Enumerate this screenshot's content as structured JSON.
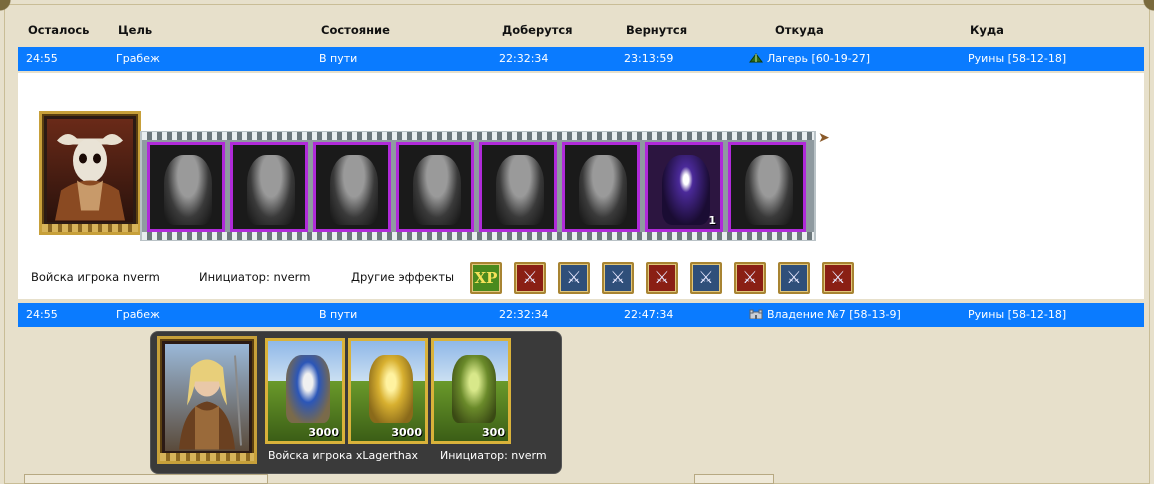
{
  "columns": {
    "remaining": "Осталось",
    "goal": "Цель",
    "state": "Состояние",
    "arrive": "Доберутся",
    "return": "Вернутся",
    "from": "Откуда",
    "to": "Куда"
  },
  "rows": [
    {
      "remaining": "24:55",
      "goal": "Грабеж",
      "state": "В пути",
      "arrive": "22:32:34",
      "return": "23:13:59",
      "from_icon": "camp-tent-icon",
      "from": "Лагерь [60-19-27]",
      "to": "Руины [58-12-18]"
    },
    {
      "remaining": "24:55",
      "goal": "Грабеж",
      "state": "В пути",
      "arrive": "22:32:34",
      "return": "22:47:34",
      "from_icon": "castle-icon",
      "from": "Владение №7 [58-13-9]",
      "to": "Руины [58-12-18]"
    }
  ],
  "expanded": {
    "hero_icon": "skull-helmet-hero-portrait",
    "units": [
      {
        "icon": "ghoul-unit-icon",
        "count": ""
      },
      {
        "icon": "death-knight-unit-icon",
        "count": ""
      },
      {
        "icon": "bone-dragon-rider-unit-icon",
        "count": ""
      },
      {
        "icon": "bone-dragon-unit-icon",
        "count": ""
      },
      {
        "icon": "dark-knight-unit-icon",
        "count": ""
      },
      {
        "icon": "banshee-unit-icon",
        "count": ""
      },
      {
        "icon": "reaper-unit-icon",
        "count": "1"
      },
      {
        "icon": "lich-unit-icon",
        "count": ""
      }
    ],
    "player_troops": "Войска игрока nverm",
    "initiator": "Инициатор: nverm",
    "other_effects": "Другие эффекты",
    "effects": [
      {
        "icon": "xp-icon",
        "label": "XP"
      },
      {
        "icon": "red-sword-icon"
      },
      {
        "icon": "sword-icon"
      },
      {
        "icon": "sword-icon"
      },
      {
        "icon": "red-sword-icon"
      },
      {
        "icon": "sword-icon"
      },
      {
        "icon": "red-sword-icon"
      },
      {
        "icon": "sword-icon"
      },
      {
        "icon": "red-sword-icon"
      }
    ]
  },
  "popup": {
    "hero_icon": "archer-heroine-portrait",
    "units": [
      {
        "icon": "peasant-donkey-unit-icon",
        "count": "3000"
      },
      {
        "icon": "cavalier-unit-icon",
        "count": "3000"
      },
      {
        "icon": "druid-unit-icon",
        "count": "300"
      }
    ],
    "player_troops": "Войска игрока xLagerthax",
    "initiator": "Инициатор: nverm"
  },
  "colors": {
    "row_blue": "#0a7bff",
    "page_bg": "#e7e0cb",
    "purple_frame": "#b02ad9",
    "gold_frame": "#d9b23a"
  }
}
